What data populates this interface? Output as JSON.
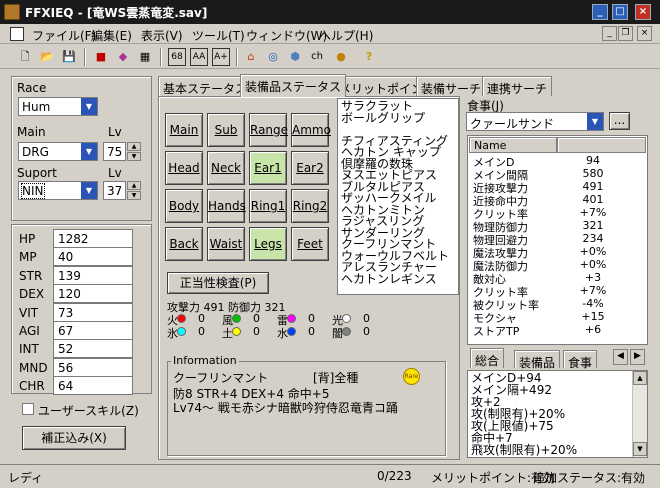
{
  "window": {
    "title": "FFXIEQ - [竜WS雲蒸竜変.sav]"
  },
  "menu": [
    "ファイル(F)",
    "編集(E)",
    "表示(V)",
    "ツール(T)",
    "ウィンドウ(W)",
    "ヘルプ(H)"
  ],
  "toolbar": {
    "ch_text": "ch"
  },
  "left": {
    "race_label": "Race",
    "race_value": "Hum",
    "main_label": "Main",
    "main_value": "DRG",
    "main_lv_label": "Lv",
    "main_lv_value": "75",
    "support_label": "Suport",
    "support_value": "NIN",
    "support_lv_label": "Lv",
    "support_lv_value": "37",
    "stats": [
      {
        "name": "HP",
        "value": "1282"
      },
      {
        "name": "MP",
        "value": "40"
      },
      {
        "name": "STR",
        "value": "139"
      },
      {
        "name": "DEX",
        "value": "120"
      },
      {
        "name": "VIT",
        "value": "73"
      },
      {
        "name": "AGI",
        "value": "67"
      },
      {
        "name": "INT",
        "value": "52"
      },
      {
        "name": "MND",
        "value": "56"
      },
      {
        "name": "CHR",
        "value": "64"
      }
    ],
    "user_skill_label": "ユーザースキル(Z)",
    "correction_button": "補正込み(X)"
  },
  "tabs": [
    "基本ステータス",
    "装備品ステータス",
    "メリットポイント",
    "装備サーチ",
    "連携サーチ"
  ],
  "slots": [
    "Main",
    "Sub",
    "Range",
    "Ammo",
    "Head",
    "Neck",
    "Ear1",
    "Ear2",
    "Body",
    "Hands",
    "Ring1",
    "Ring2",
    "Back",
    "Waist",
    "Legs",
    "Feet"
  ],
  "gear_list": [
    "サラクラット",
    "ボールグリップ",
    "",
    "チフィアスティング",
    "ヘカトン キャップ",
    "倶摩羅の数珠",
    "ヌスエットピアス",
    "ブルタルピアス",
    "ザッハークメイル",
    "ヘカトンミトン",
    "ラジャスリング",
    "サンダーリング",
    "クーフリンマント",
    "ウォーウルフベルト",
    "アレスランチャー",
    "ヘカトンレギンス"
  ],
  "validity_button": "正当性検査(P)",
  "attack_defense": "攻撃力 491 防御力 321",
  "elements": [
    {
      "name": "火",
      "value": "0",
      "color": "#ff0000"
    },
    {
      "name": "風",
      "value": "0",
      "color": "#00c000"
    },
    {
      "name": "雷",
      "value": "0",
      "color": "#ff00ff"
    },
    {
      "name": "光",
      "value": "0",
      "color": "#ffffff"
    },
    {
      "name": "氷",
      "value": "0",
      "color": "#00ffff"
    },
    {
      "name": "土",
      "value": "0",
      "color": "#ffff00"
    },
    {
      "name": "水",
      "value": "0",
      "color": "#0040ff"
    },
    {
      "name": "闇",
      "value": "0",
      "color": "#808080"
    }
  ],
  "information": {
    "label": "Information",
    "item_name": "クーフリンマント",
    "item_type": "[背]全種",
    "badge": "Rare",
    "line1": "防8 STR+4 DEX+4 命中+5",
    "line2": "Lv74～ 戦モ赤シナ暗獣吟狩侍忍竜青コ踊"
  },
  "food": {
    "label": "食事(J)",
    "value": "クァールサンド",
    "more_button": "...",
    "header_name": "Name",
    "rows": [
      {
        "name": "メインD",
        "value": "94"
      },
      {
        "name": "メイン間隔",
        "value": "580"
      },
      {
        "name": "近接攻撃力",
        "value": "491"
      },
      {
        "name": "近接命中力",
        "value": "401"
      },
      {
        "name": "クリット率",
        "value": "+7%"
      },
      {
        "name": "物理防御力",
        "value": "321"
      },
      {
        "name": "物理回避力",
        "value": "234"
      },
      {
        "name": "魔法攻撃力",
        "value": "+0%"
      },
      {
        "name": "魔法防御力",
        "value": "+0%"
      },
      {
        "name": "敵対心",
        "value": "+3"
      },
      {
        "name": "クリット率",
        "value": "+7%"
      },
      {
        "name": "被クリット率",
        "value": "-4%"
      },
      {
        "name": "モクシャ",
        "value": "+15"
      },
      {
        "name": "ストアTP",
        "value": "+6"
      }
    ]
  },
  "bottom_tabs": [
    "総合",
    "装備品",
    "食事"
  ],
  "summary_list": [
    "メインD+94",
    "メイン隔+492",
    "攻+2",
    "攻(制限有)+20%",
    "攻(上限値)+75",
    "命中+7",
    "飛攻(制限有)+20%"
  ],
  "statusbar": {
    "left": "レディ",
    "count": "0/223",
    "merit": "メリットポイント:有効",
    "extra": "追加ステータス:有効"
  }
}
